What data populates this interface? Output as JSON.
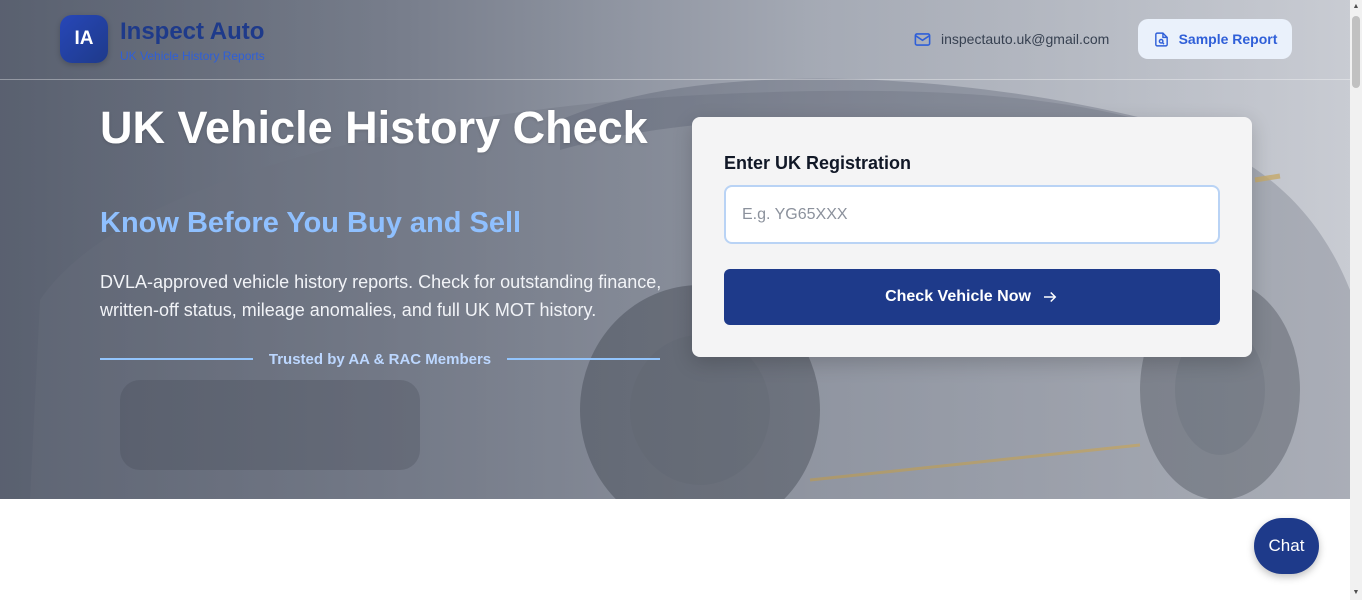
{
  "header": {
    "logo_initials": "IA",
    "brand_name": "Inspect Auto",
    "brand_tagline": "UK Vehicle History Reports",
    "email": "inspectauto.uk@gmail.com",
    "sample_report_label": "Sample Report"
  },
  "hero": {
    "title": "UK Vehicle History Check",
    "subtitle": "Know Before You Buy and Sell",
    "description": "DVLA-approved vehicle history reports. Check for outstanding finance, written-off status, mileage anomalies, and full UK MOT history.",
    "trusted_text": "Trusted by AA & RAC Members"
  },
  "form": {
    "label": "Enter UK Registration",
    "input_value": "",
    "input_placeholder": "E.g. YG65XXX",
    "submit_label": "Check Vehicle Now"
  },
  "chat": {
    "label": "Chat"
  },
  "colors": {
    "primary": "#1e3a8a",
    "accent": "#2f5fd8",
    "subtitle": "#8fc0ff"
  },
  "icons": {
    "email": "mail-icon",
    "sample_report": "document-search-icon",
    "submit": "arrow-right-icon"
  }
}
